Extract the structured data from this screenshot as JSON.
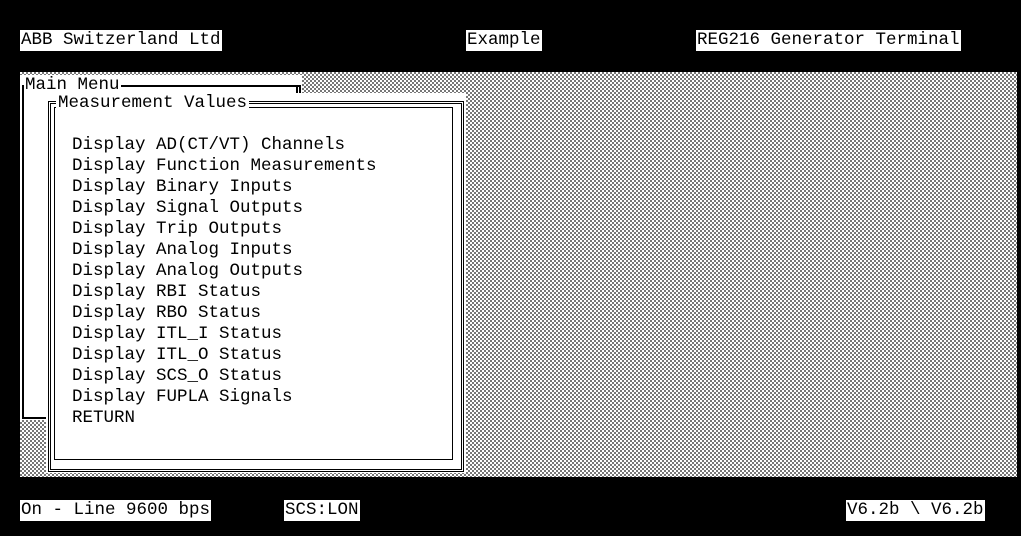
{
  "header": {
    "company": "ABB Switzerland Ltd",
    "project": "Example",
    "device": "REG216 Generator Terminal"
  },
  "main_menu": {
    "title": "Main Menu"
  },
  "measurement_menu": {
    "title": "Measurement Values",
    "items": [
      "Display AD(CT/VT) Channels",
      "Display Function Measurements",
      "Display Binary Inputs",
      "Display Signal Outputs",
      "Display Trip Outputs",
      "Display Analog Inputs",
      "Display Analog Outputs",
      "Display RBI Status",
      "Display RBO Status",
      "Display ITL_I Status",
      "Display ITL_O Status",
      "Display SCS_O Status",
      "Display FUPLA Signals",
      "RETURN"
    ]
  },
  "status_bar": {
    "connection": "On - Line 9600 bps",
    "protocol": "SCS:LON",
    "version": "V6.2b \\ V6.2b"
  }
}
